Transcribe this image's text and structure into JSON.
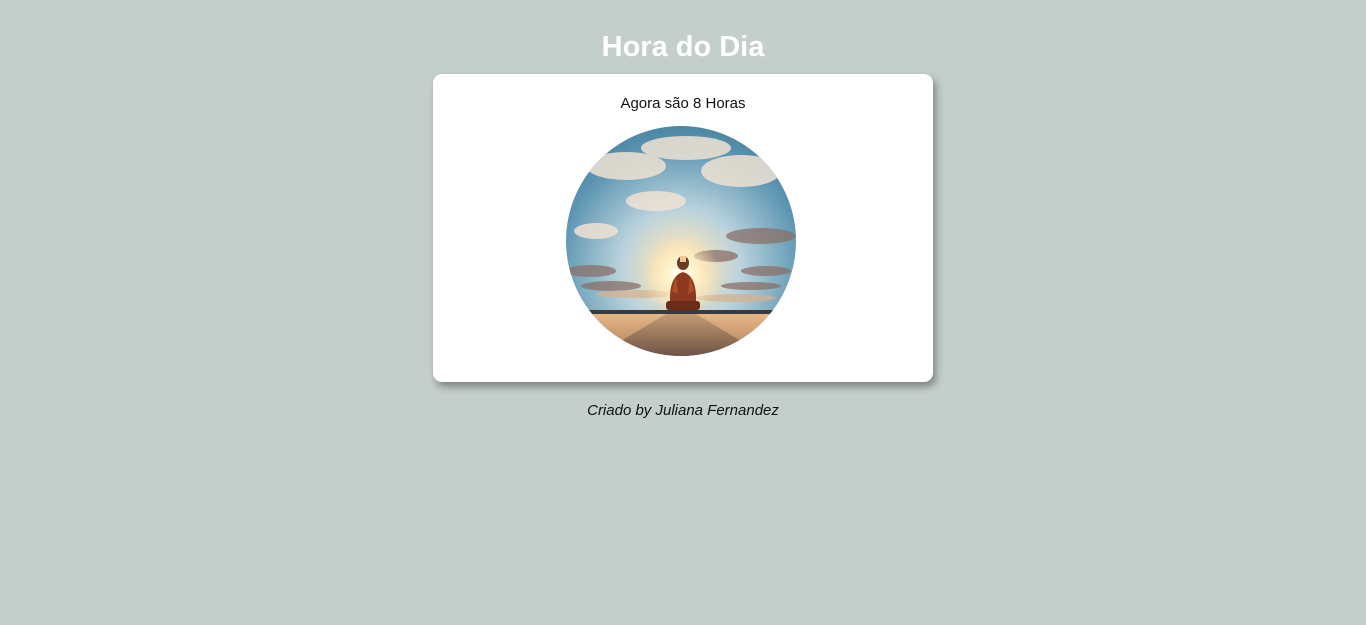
{
  "header": {
    "title": "Hora do Dia"
  },
  "card": {
    "message": "Agora são 8 Horas",
    "image_icon": "sunrise-person-photo"
  },
  "footer": {
    "credit": "Criado by Juliana Fernandez"
  },
  "colors": {
    "background": "#c4cecb",
    "card": "#ffffff",
    "title": "#ffffff"
  }
}
